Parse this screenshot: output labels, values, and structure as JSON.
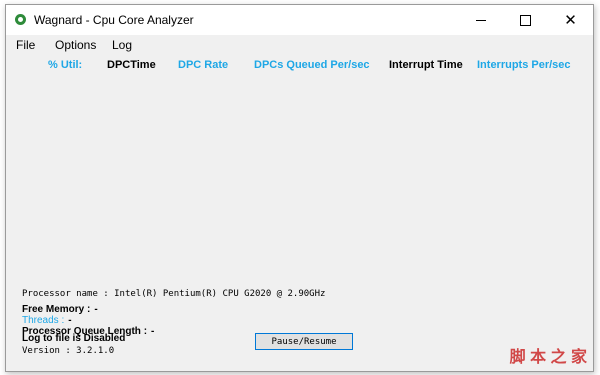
{
  "window": {
    "title": "Wagnard - Cpu Core Analyzer"
  },
  "menu": [
    "File",
    "Options",
    "Log"
  ],
  "columns": [
    {
      "label": "% Util:",
      "color": "#1ea7e6"
    },
    {
      "label": "DPCTime",
      "color": "#000000"
    },
    {
      "label": "DPC Rate",
      "color": "#1ea7e6"
    },
    {
      "label": "DPCs Queued Per/sec",
      "color": "#1ea7e6"
    },
    {
      "label": "Interrupt Time",
      "color": "#000000"
    },
    {
      "label": "Interrupts Per/sec",
      "color": "#1ea7e6"
    }
  ],
  "info": {
    "processor_name": "Processor name : Intel(R) Pentium(R) CPU G2020 @ 2.90GHz",
    "free_memory_label": "Free Memory :",
    "free_memory_value": "-",
    "threads_label": "Threads :",
    "threads_value": "-",
    "queue_label": "Processor Queue Length :",
    "queue_value": "-",
    "log_status": "Log to file is Disabled",
    "version": "Version : 3.2.1.0"
  },
  "buttons": {
    "pause_resume": "Pause/Resume"
  },
  "watermark": {
    "text": "脚 本 之 家"
  },
  "colors": {
    "accent": "#1ea7e6",
    "app_icon": "#2e8b3a",
    "button_border": "#0078d7"
  }
}
